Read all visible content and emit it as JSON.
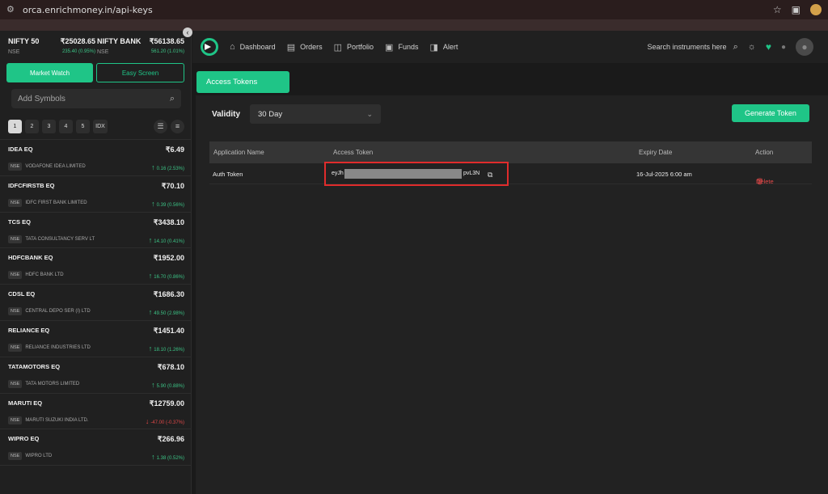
{
  "browser": {
    "url": "orca.enrichmoney.in/api-keys",
    "icons": [
      "site-settings-icon",
      "star-icon",
      "extensions-icon",
      "profile-icon"
    ]
  },
  "indices": [
    {
      "name": "NIFTY 50",
      "value": "₹25028.65",
      "exchange": "NSE",
      "change": "235.40 (0.95%)"
    },
    {
      "name": "NIFTY BANK",
      "value": "₹56138.65",
      "exchange": "NSE",
      "change": "561.20 (1.01%)"
    }
  ],
  "sidebar": {
    "tab_market_watch": "Market Watch",
    "tab_easy_screen": "Easy Screen",
    "search_placeholder": "Add Symbols",
    "pages": [
      "1",
      "2",
      "3",
      "4",
      "5",
      "IDX"
    ],
    "active_page": "1"
  },
  "watchlist": [
    {
      "symbol": "IDEA EQ",
      "price": "₹6.49",
      "exchange": "NSE",
      "company": "VODAFONE IDEA LIMITED",
      "change": "0.16 (2.53%)",
      "direction": "up"
    },
    {
      "symbol": "IDFCFIRSTB EQ",
      "price": "₹70.10",
      "exchange": "NSE",
      "company": "IDFC FIRST BANK LIMITED",
      "change": "0.39 (0.56%)",
      "direction": "up"
    },
    {
      "symbol": "TCS EQ",
      "price": "₹3438.10",
      "exchange": "NSE",
      "company": "TATA CONSULTANCY SERV LT",
      "change": "14.10 (0.41%)",
      "direction": "up"
    },
    {
      "symbol": "HDFCBANK EQ",
      "price": "₹1952.00",
      "exchange": "NSE",
      "company": "HDFC BANK LTD",
      "change": "16.70 (0.86%)",
      "direction": "up"
    },
    {
      "symbol": "CDSL EQ",
      "price": "₹1686.30",
      "exchange": "NSE",
      "company": "CENTRAL DEPO SER (I) LTD",
      "change": "49.50 (2.98%)",
      "direction": "up"
    },
    {
      "symbol": "RELIANCE EQ",
      "price": "₹1451.40",
      "exchange": "NSE",
      "company": "RELIANCE INDUSTRIES LTD",
      "change": "18.10 (1.26%)",
      "direction": "up"
    },
    {
      "symbol": "TATAMOTORS EQ",
      "price": "₹678.10",
      "exchange": "NSE",
      "company": "TATA MOTORS LIMITED",
      "change": "5.90 (0.88%)",
      "direction": "up"
    },
    {
      "symbol": "MARUTI EQ",
      "price": "₹12759.00",
      "exchange": "NSE",
      "company": "MARUTI SUZUKI INDIA LTD.",
      "change": "-47.00 (-0.37%)",
      "direction": "down"
    },
    {
      "symbol": "WIPRO EQ",
      "price": "₹266.96",
      "exchange": "NSE",
      "company": "WIPRO LTD",
      "change": "1.38 (0.52%)",
      "direction": "up"
    }
  ],
  "nav": {
    "items": [
      "Dashboard",
      "Orders",
      "Portfolio",
      "Funds",
      "Alert"
    ],
    "search_placeholder": "Search instruments here"
  },
  "main": {
    "tab_label": "Access Tokens",
    "validity_label": "Validity",
    "validity_value": "30 Day",
    "generate_label": "Generate Token",
    "columns": [
      "Application Name",
      "Access Token",
      "Expiry Date",
      "Action"
    ],
    "rows": [
      {
        "app_name": "Auth Token",
        "token_start": "eyJh",
        "token_end": "pvL3N",
        "expiry": "16-Jul-2025 6:00 am",
        "action": "Delete"
      }
    ]
  },
  "colors": {
    "accent": "#1fc587",
    "danger": "#e04848",
    "highlight_box": "#e02c2c"
  }
}
